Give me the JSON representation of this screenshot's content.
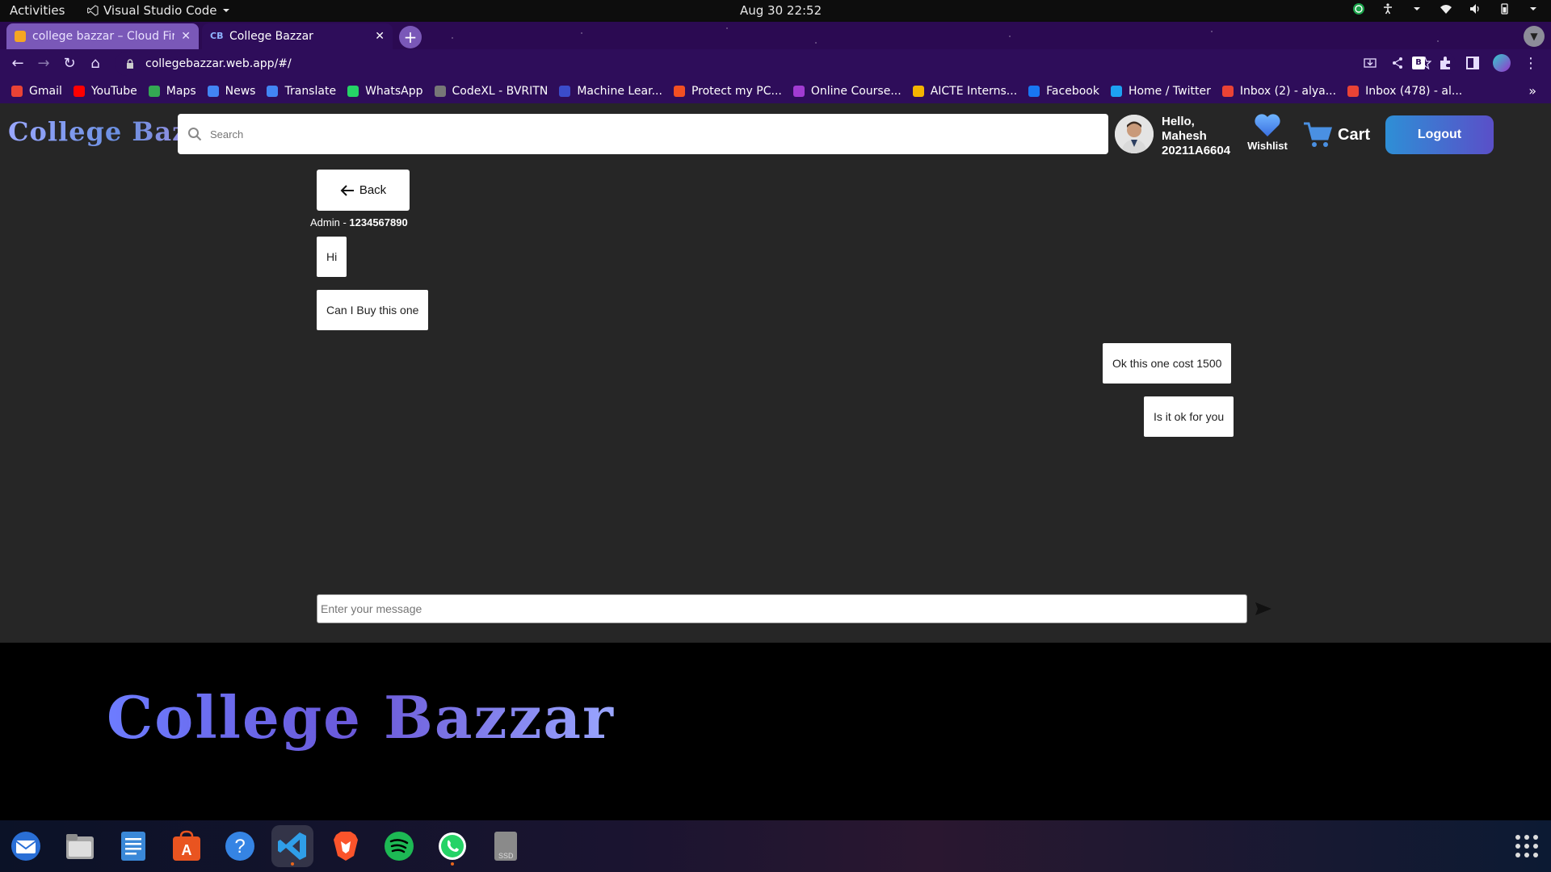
{
  "topbar": {
    "activities": "Activities",
    "app_name": "Visual Studio Code",
    "clock": "Aug 30  22:52"
  },
  "browser": {
    "tabs": [
      {
        "title": "college bazzar – Cloud Fir",
        "active": false
      },
      {
        "title": "College Bazzar",
        "active": true
      }
    ],
    "url": "collegebazzar.web.app/#/",
    "bookmarks": [
      {
        "label": "Gmail",
        "icon_color": "#ea4335"
      },
      {
        "label": "YouTube",
        "icon_color": "#ff0000"
      },
      {
        "label": "Maps",
        "icon_color": "#34a853"
      },
      {
        "label": "News",
        "icon_color": "#4285f4"
      },
      {
        "label": "Translate",
        "icon_color": "#4285f4"
      },
      {
        "label": "WhatsApp",
        "icon_color": "#25d366"
      },
      {
        "label": "CodeXL - BVRITN",
        "icon_color": "#777777"
      },
      {
        "label": "Machine Lear...",
        "icon_color": "#3b4cca"
      },
      {
        "label": "Protect my PC...",
        "icon_color": "#f25022"
      },
      {
        "label": "Online Course...",
        "icon_color": "#a13bd1"
      },
      {
        "label": "AICTE Interns...",
        "icon_color": "#f4b400"
      },
      {
        "label": "Facebook",
        "icon_color": "#1877f2"
      },
      {
        "label": "Home / Twitter",
        "icon_color": "#1da1f2"
      },
      {
        "label": "Inbox (2) - alya...",
        "icon_color": "#ea4335"
      },
      {
        "label": "Inbox (478) - al...",
        "icon_color": "#ea4335"
      }
    ]
  },
  "site": {
    "brand": "College Bazzar",
    "search_placeholder": "Search",
    "greeting": "Hello,",
    "user_name": "Mahesh",
    "user_id": "20211A6604",
    "wishlist_label": "Wishlist",
    "cart_label": "Cart",
    "logout_label": "Logout"
  },
  "chat": {
    "back_label": "Back",
    "contact_name": "Admin - ",
    "contact_phone": "1234567890",
    "messages": [
      {
        "text": "Hi",
        "side": "left"
      },
      {
        "text": "Can I Buy this one",
        "side": "left"
      },
      {
        "text": "Ok this one cost 1500",
        "side": "right"
      },
      {
        "text": "Is it ok for you",
        "side": "right"
      }
    ],
    "input_placeholder": "Enter your message"
  },
  "footer": {
    "brand": "College Bazzar"
  },
  "dock": {
    "apps": [
      "thunderbird-icon",
      "files-icon",
      "text-editor-icon",
      "software-store-icon",
      "help-icon",
      "vscode-icon",
      "brave-icon",
      "spotify-icon",
      "whatsapp-icon",
      "ssd-drive-icon"
    ],
    "drive_label": "SSD"
  }
}
